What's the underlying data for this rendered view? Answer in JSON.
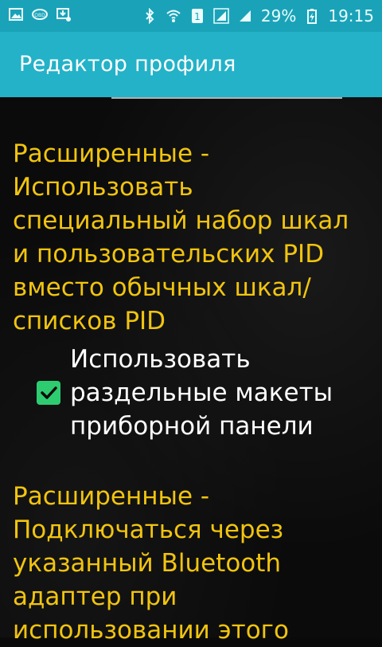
{
  "status_bar": {
    "left_icons": [
      "gallery-icon",
      "obd-icon",
      "download-icon"
    ],
    "right_icons": [
      "bluetooth-icon",
      "wifi-icon",
      "sim1-icon",
      "signal-icon",
      "signal2-icon",
      "battery-icon"
    ],
    "battery_percent": "29%",
    "time": "19:15"
  },
  "appbar": {
    "title": "Редактор профиля"
  },
  "content": {
    "setting1_text": "Расширенные - Использовать специальный набор шкал и пользовательских PID вместо обычных шкал/списков PID",
    "checkbox_label": "Использовать раздельные макеты приборной панели",
    "checkbox_checked": true,
    "setting2_text": "Расширенные - Подключаться через указанный Bluetooth адаптер при использовании этого"
  },
  "colors": {
    "status_bar": "#1aa3b8",
    "appbar": "#23b2c8",
    "text_yellow": "#f1c40f",
    "checkbox": "#2ecc71"
  }
}
